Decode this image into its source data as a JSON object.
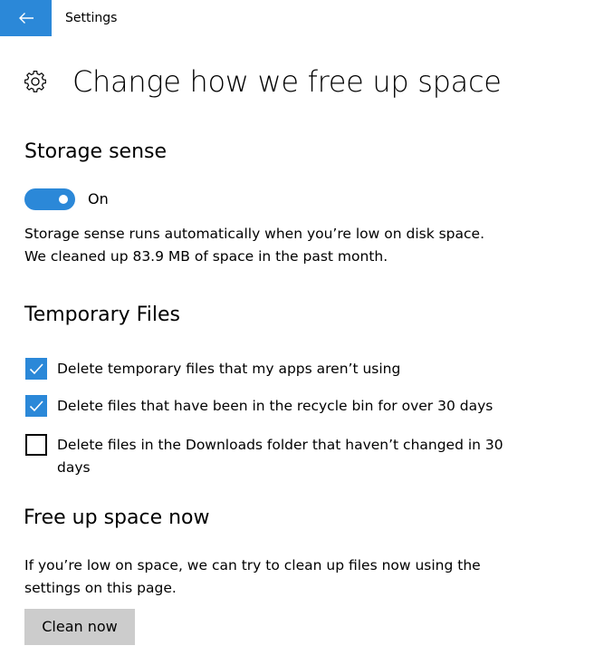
{
  "colors": {
    "accent": "#2b88d8",
    "button_bg": "#cccccc",
    "text": "#000000",
    "background": "#ffffff"
  },
  "topbar": {
    "back_icon": "arrow-left-icon",
    "title": "Settings"
  },
  "header": {
    "icon": "gear-icon",
    "title": "Change how we free up space"
  },
  "storage_sense": {
    "title": "Storage sense",
    "toggle_state": "on",
    "toggle_label": "On",
    "description_line1": "Storage sense runs automatically when you’re low on disk space.",
    "description_line2": "We cleaned up 83.9 MB of space in the past month."
  },
  "temporary_files": {
    "title": "Temporary Files",
    "options": [
      {
        "label": "Delete temporary files that my apps aren’t using",
        "checked": true
      },
      {
        "label": "Delete files that have been in the recycle bin for over 30 days",
        "checked": true
      },
      {
        "label": "Delete files in the Downloads folder that haven’t changed in 30 days",
        "checked": false
      }
    ]
  },
  "free_up": {
    "title": "Free up space now",
    "description_line1": "If you’re low on space, we can try to clean up files now using the",
    "description_line2": "settings on this page.",
    "button_label": "Clean now"
  }
}
